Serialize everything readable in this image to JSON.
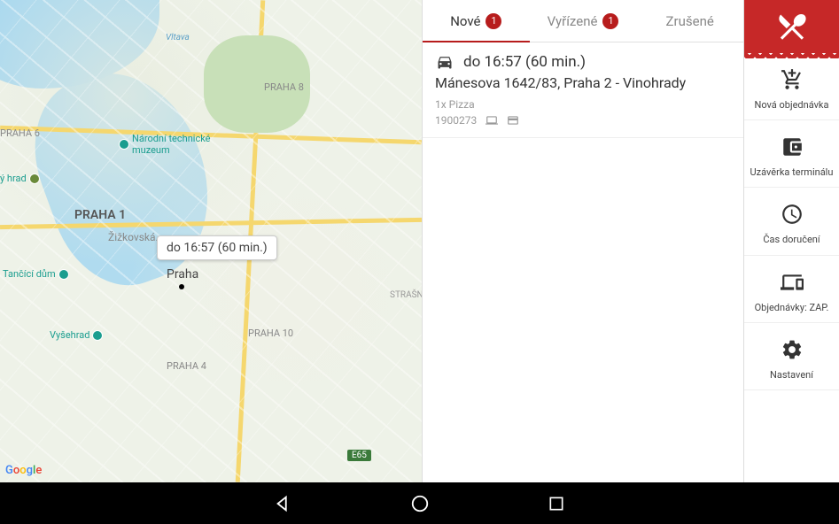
{
  "tabs": {
    "new": {
      "label": "Nové",
      "badge": "1"
    },
    "done": {
      "label": "Vyřízené",
      "badge": "1"
    },
    "cancelled": {
      "label": "Zrušené"
    }
  },
  "order": {
    "time_label": "do 16:57 (60 min.)",
    "address": "Mánesova 1642/83, Praha 2 - Vinohrady",
    "items": "1x Pizza",
    "id": "1900273"
  },
  "sidebar": {
    "new_order": "Nová objednávka",
    "terminal_close": "Uzávěrka terminálu",
    "delivery_time": "Čas doručení",
    "orders_status": "Objednávky: ZAP.",
    "settings": "Nastavení"
  },
  "map": {
    "tooltip": "do 16:57 (60 min.)",
    "center_label": "Praha",
    "districts": {
      "praha1": "PRAHA 1",
      "praha6": "PRAHA 6",
      "praha8": "PRAHA 8",
      "praha4": "PRAHA 4",
      "praha10": "PRAHA 10"
    },
    "neighborhoods": {
      "zizkovska": "Žižkovská...",
      "vltava": "Vltava"
    },
    "poi": {
      "museum": "Národní technické\nmuzeum",
      "dancing": "Tančící dům",
      "vysehrad": "Vyšehrad",
      "hrad": "ý hrad"
    },
    "roads": {
      "e65": "E65",
      "strasn": "STRAŠN"
    },
    "attribution": "Google"
  }
}
